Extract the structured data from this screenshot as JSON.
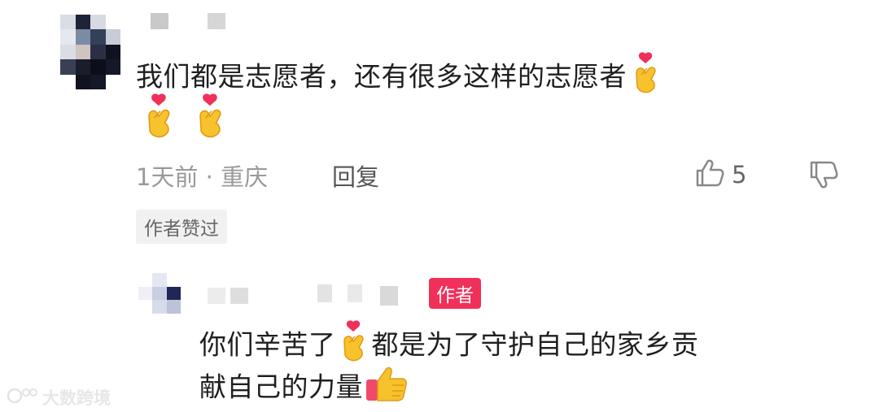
{
  "comment": {
    "text_line1": "我们都是志愿者，还有很多这样的志愿者",
    "time_location": "1天前 · 重庆",
    "reply_label": "回复",
    "like_count": "5",
    "author_liked_badge": "作者赞过",
    "emojis": [
      "finger-heart",
      "finger-heart",
      "finger-heart"
    ]
  },
  "reply": {
    "author_badge": "作者",
    "text_line1_a": "你们辛苦了",
    "text_line1_b": "都是为了守护自己的家乡贡",
    "text_line2": "献自己的力量",
    "emojis": [
      "finger-heart",
      "thumbs-up"
    ]
  },
  "watermark": {
    "text": "大数跨境"
  },
  "colors": {
    "accent": "#f1305a",
    "meta": "#9a9a9a"
  }
}
